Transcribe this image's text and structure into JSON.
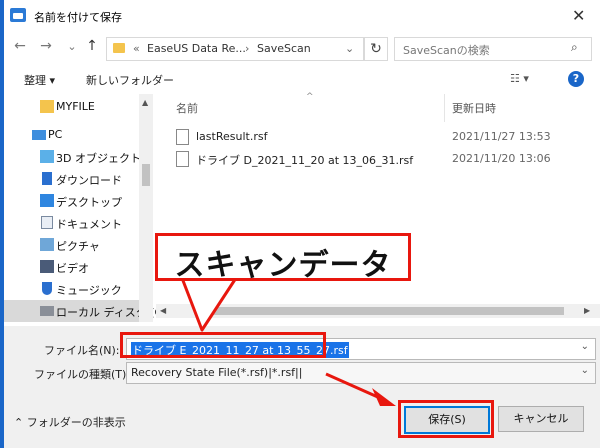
{
  "window": {
    "title": "名前を付けて保存",
    "close_glyph": "✕"
  },
  "address": {
    "back": "←",
    "forward": "→",
    "recent": "⌄",
    "up": "↑",
    "overflow": "«",
    "crumbs": [
      "EaseUS Data Re...",
      "SaveScan"
    ],
    "separator": "›",
    "dropdown": "⌄",
    "refresh": "↻"
  },
  "search": {
    "placeholder": "SaveScanの検索",
    "icon": "search-icon",
    "glyph": "⌕"
  },
  "toolbar": {
    "organize": "整理 ▾",
    "new_folder": "新しいフォルダー",
    "view_glyph": "☷ ▾",
    "help": "?"
  },
  "nav": {
    "items": [
      {
        "label": "MYFILE",
        "icon": "folder-icon"
      },
      {
        "label": "PC",
        "icon": "pc-icon"
      },
      {
        "label": "3D オブジェクト",
        "icon": "3d-objects-icon"
      },
      {
        "label": "ダウンロード",
        "icon": "download-icon"
      },
      {
        "label": "デスクトップ",
        "icon": "desktop-icon"
      },
      {
        "label": "ドキュメント",
        "icon": "documents-icon"
      },
      {
        "label": "ピクチャ",
        "icon": "pictures-icon"
      },
      {
        "label": "ビデオ",
        "icon": "videos-icon"
      },
      {
        "label": "ミュージック",
        "icon": "music-icon"
      },
      {
        "label": "ローカル ディスク (C",
        "icon": "disk-icon"
      }
    ]
  },
  "files": {
    "headers": {
      "name": "名前",
      "modified": "更新日時",
      "sort_glyph": "^"
    },
    "rows": [
      {
        "name": "lastResult.rsf",
        "modified": "2021/11/27 13:53"
      },
      {
        "name": "ドライブ D_2021_11_20 at 13_06_31.rsf",
        "modified": "2021/11/20 13:06"
      }
    ]
  },
  "form": {
    "filename_label": "ファイル名(N):",
    "filename_value": "ドライブ E_2021_11_27 at 13_55_27.rsf",
    "filetype_label": "ファイルの種類(T):",
    "filetype_value": "Recovery State File(*.rsf)|*.rsf||",
    "dropdown_glyph": "⌄",
    "hide_folders": "⌃ フォルダーの非表示",
    "save_button": "保存(S)",
    "cancel_button": "キャンセル"
  },
  "annotation": {
    "callout": "スキャンデータ",
    "color": "#e8170e"
  }
}
